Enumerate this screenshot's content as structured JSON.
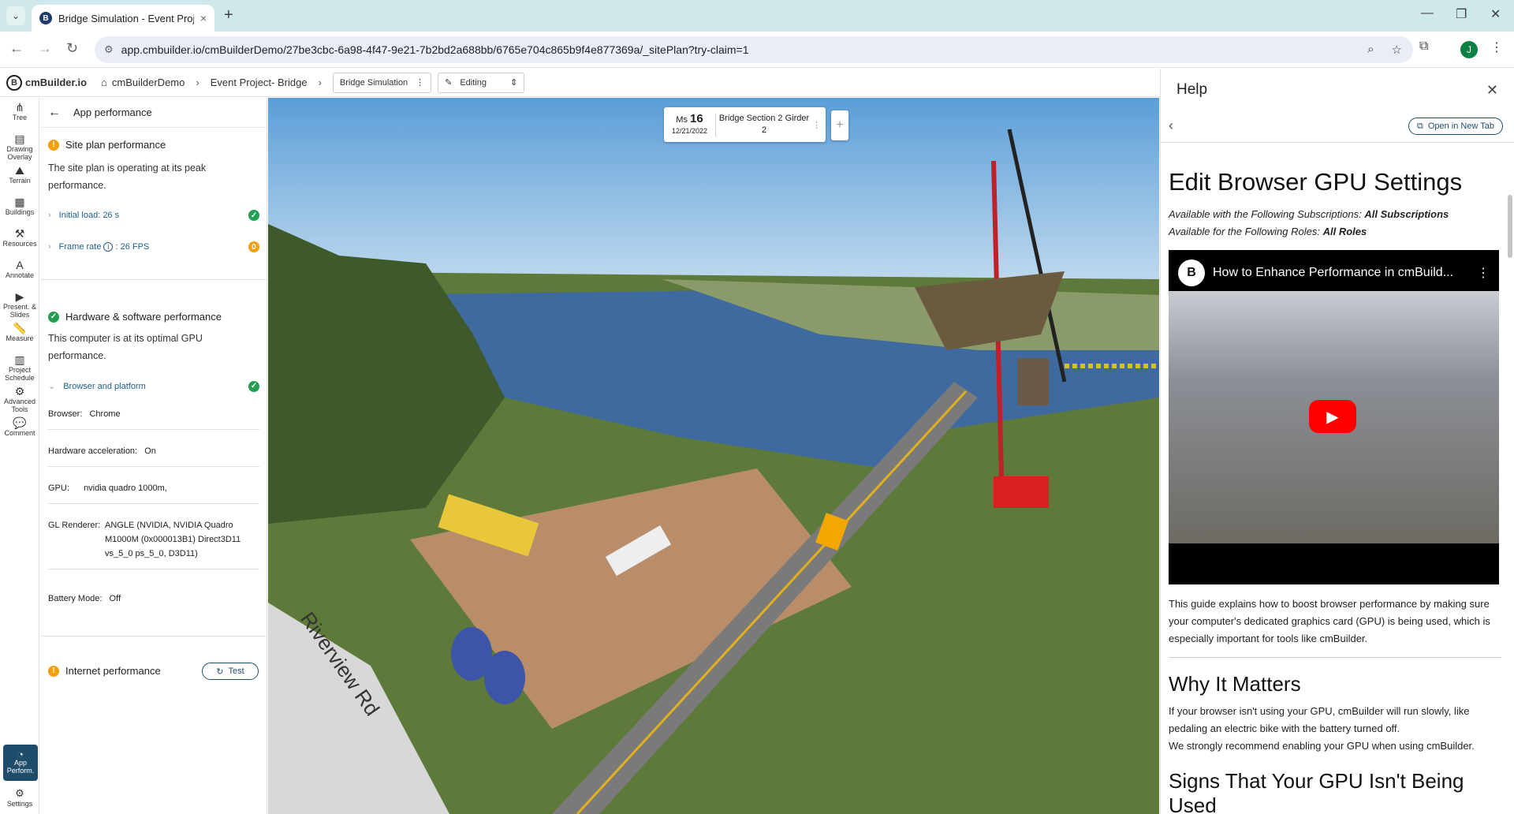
{
  "browser": {
    "tab_title": "Bridge Simulation - Event Proje",
    "tab_close": "×",
    "new_tab": "+",
    "url": "app.cmbuilder.io/cmBuilderDemo/27be3cbc-6a98-4f47-9e21-7b2bd2a688bb/6765e704c865b9f4e877369a/_sitePlan?try-claim=1",
    "profile_initial": "J",
    "minimize": "—",
    "restore": "❐",
    "close": "✕"
  },
  "appbar": {
    "logo": "cmBuilder.io",
    "logo_letter": "B",
    "crumb_home": "cmBuilderDemo",
    "crumb_project": "Event Project- Bridge",
    "scene_select": "Bridge Simulation",
    "mode_select": "Editing"
  },
  "rail": [
    {
      "label": "Tree",
      "icon": "tree-icon"
    },
    {
      "label": "Drawing Overlay",
      "icon": "drawing-overlay-icon"
    },
    {
      "label": "Terrain",
      "icon": "terrain-icon"
    },
    {
      "label": "Buildings",
      "icon": "buildings-icon"
    },
    {
      "label": "Resources",
      "icon": "resources-icon"
    },
    {
      "label": "Annotate",
      "icon": "annotate-icon"
    },
    {
      "label": "Present. & Slides",
      "icon": "present-icon"
    },
    {
      "label": "Measure",
      "icon": "measure-icon"
    },
    {
      "label": "Project Schedule",
      "icon": "schedule-icon"
    },
    {
      "label": "Advanced Tools",
      "icon": "advanced-tools-icon"
    },
    {
      "label": "Comment",
      "icon": "comment-icon"
    }
  ],
  "rail_active": {
    "line1": "App",
    "line2": "Perform."
  },
  "rail_settings": "Settings",
  "panel": {
    "title": "App performance",
    "site": {
      "title": "Site plan performance",
      "desc": "The site plan is operating at its peak performance.",
      "initial_load": "Initial load: 26 s",
      "frame_rate_label": "Frame rate",
      "frame_rate_value": ": 26 FPS",
      "frame_rate_badge": "0"
    },
    "hw": {
      "title": "Hardware & software performance",
      "desc": "This computer is at its optimal GPU performance.",
      "browser_platform": "Browser and platform",
      "browser_k": "Browser:",
      "browser_v": "Chrome",
      "accel_k": "Hardware acceleration:",
      "accel_v": "On",
      "gpu_k": "GPU:",
      "gpu_v": "nvidia quadro 1000m,",
      "gl_k": "GL Renderer:",
      "gl_v": "ANGLE (NVIDIA, NVIDIA Quadro M1000M (0x000013B1) Direct3D11 vs_5_0 ps_5_0, D3D11)",
      "battery_k": "Battery Mode:",
      "battery_v": "Off"
    },
    "internet": {
      "title": "Internet performance",
      "test": "Test"
    }
  },
  "milestone": {
    "prefix": "Ms",
    "number": "16",
    "date": "12/21/2022",
    "name": "Bridge Section 2 Girder",
    "sub": "2"
  },
  "scene_label": "Riverview Rd",
  "help": {
    "title": "Help",
    "open_new_tab": "Open in New Tab",
    "h1": "Edit Browser GPU Settings",
    "subs_prefix": "Available with the Following Subscriptions: ",
    "subs_value": "All Subscriptions",
    "roles_prefix": "Available for the Following Roles: ",
    "roles_value": "All Roles",
    "video_title": "How to Enhance Performance in cmBuild...",
    "video_logo": "B",
    "para1": "This guide explains how to boost browser performance by making sure your computer's dedicated graphics card (GPU) is being used, which is especially important for tools like cmBuilder.",
    "h2a": "Why It Matters",
    "para2": "If your browser isn't using your GPU, cmBuilder will run slowly, like pedaling an electric bike with the battery turned off.",
    "para3": "We strongly recommend enabling your GPU when using cmBuilder.",
    "h2b": "Signs That Your GPU Isn't Being Used"
  },
  "colors": {
    "accent": "#1e4d6b",
    "ok": "#22a052",
    "warn": "#f59e0b"
  }
}
